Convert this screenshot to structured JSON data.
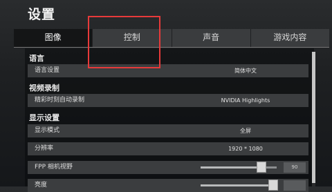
{
  "window": {
    "title": "设置"
  },
  "tabs": [
    {
      "label": "图像",
      "active": true
    },
    {
      "label": "控制",
      "active": false
    },
    {
      "label": "声音",
      "active": false
    },
    {
      "label": "游戏内容",
      "active": false
    }
  ],
  "sections": {
    "language": {
      "heading": "语言",
      "rows": [
        {
          "label": "语言设置",
          "value": "简体中文"
        }
      ]
    },
    "video_recording": {
      "heading": "视频录制",
      "rows": [
        {
          "label": "精彩时刻自动录制",
          "value": "NVIDIA Highlights"
        }
      ]
    },
    "display": {
      "heading": "显示设置",
      "rows": [
        {
          "label": "显示模式",
          "value": "全屏"
        },
        {
          "label": "分辨率",
          "value": "1920 * 1080"
        },
        {
          "label": "FPP 相机视野",
          "value": "90",
          "slider_fraction": 0.8
        },
        {
          "label": "亮度",
          "value": "",
          "slider_fraction": 0.95
        }
      ]
    }
  },
  "colors": {
    "highlight": "#e83a3a",
    "row_bg": "#3b3d3f",
    "active_tab_bg": "#141516"
  }
}
